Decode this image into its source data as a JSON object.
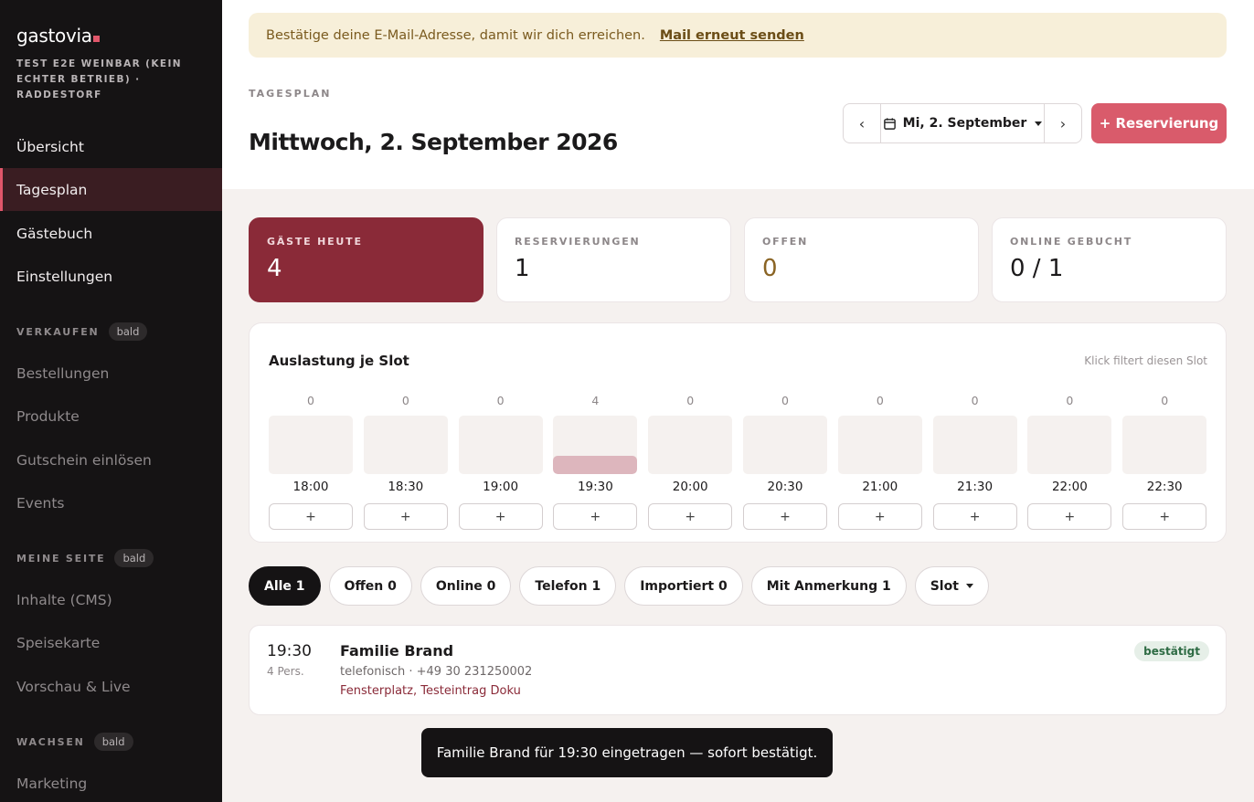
{
  "sidebar": {
    "brand": "gastovia",
    "venue": "TEST E2E WEINBAR (KEIN ECHTER BETRIEB) · RADDESTORF",
    "nav": {
      "overview": "Übersicht",
      "dayplan": "Tagesplan",
      "guestbook": "Gästebuch",
      "settings": "Einstellungen"
    },
    "sections": {
      "sell": {
        "label": "VERKAUFEN",
        "badge": "bald",
        "items": [
          "Bestellungen",
          "Produkte",
          "Gutschein einlösen",
          "Events"
        ]
      },
      "mypage": {
        "label": "MEINE SEITE",
        "badge": "bald",
        "items": [
          "Inhalte (CMS)",
          "Speisekarte",
          "Vorschau & Live"
        ]
      },
      "grow": {
        "label": "WACHSEN",
        "badge": "bald",
        "items": [
          "Marketing"
        ]
      }
    }
  },
  "banner": {
    "text": "Bestätige deine E-Mail-Adresse, damit wir dich erreichen.",
    "link": "Mail erneut senden"
  },
  "header": {
    "eyebrow": "TAGESPLAN",
    "title": "Mittwoch, 2. September 2026",
    "prev": "‹",
    "next": "›",
    "date_label": "Mi, 2. September",
    "add_label": "+ Reservierung"
  },
  "stats": [
    {
      "label": "GÄSTE HEUTE",
      "value": "4"
    },
    {
      "label": "RESERVIERUNGEN",
      "value": "1"
    },
    {
      "label": "OFFEN",
      "value": "0"
    },
    {
      "label": "ONLINE GEBUCHT",
      "value": "0 / 1"
    }
  ],
  "slots": {
    "title": "Auslastung je Slot",
    "hint": "Klick filtert diesen Slot",
    "plus": "+",
    "max_guests": 12,
    "items": [
      {
        "time": "18:00",
        "count": 0
      },
      {
        "time": "18:30",
        "count": 0
      },
      {
        "time": "19:00",
        "count": 0
      },
      {
        "time": "19:30",
        "count": 4
      },
      {
        "time": "20:00",
        "count": 0
      },
      {
        "time": "20:30",
        "count": 0
      },
      {
        "time": "21:00",
        "count": 0
      },
      {
        "time": "21:30",
        "count": 0
      },
      {
        "time": "22:00",
        "count": 0
      },
      {
        "time": "22:30",
        "count": 0
      }
    ]
  },
  "filters": {
    "all": "Alle 1",
    "open": "Offen 0",
    "online": "Online 0",
    "phone": "Telefon 1",
    "imported": "Importiert 0",
    "noted": "Mit Anmerkung 1",
    "slot": "Slot"
  },
  "reservation": {
    "time": "19:30",
    "persons": "4 Pers.",
    "name": "Familie Brand",
    "meta": "telefonisch · +49 30 231250002",
    "note": "Fensterplatz, Testeintrag Doku",
    "status": "bestätigt"
  },
  "toast": "Familie Brand für 19:30 eingetragen — sofort bestätigt.",
  "colors": {
    "accent": "#d95b6b",
    "highlight_card": "#8a2a38",
    "sidebar_bg": "#151314",
    "status_confirmed": "#2e6b44"
  }
}
